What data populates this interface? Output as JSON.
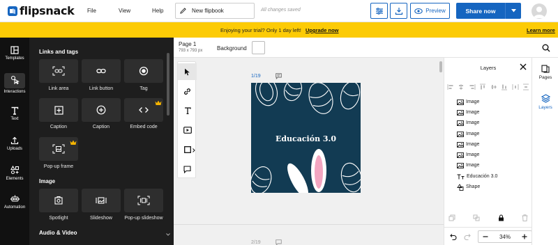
{
  "app": {
    "brand": "flipsnack",
    "menu": [
      "File",
      "View",
      "Help"
    ],
    "flipbook_title": "New flipbook",
    "save_status": "All changes saved",
    "preview_label": "Preview",
    "share_label": "Share now",
    "accent_color": "#1565c0"
  },
  "banner": {
    "message": "Enjoying your trial? Only 1 day left!",
    "upgrade_link": "Upgrade now",
    "learn_more": "Learn more",
    "color": "#fccb06"
  },
  "rail": {
    "items": [
      {
        "label": "Templates",
        "icon": "templates-icon"
      },
      {
        "label": "Interactions",
        "icon": "interactions-icon",
        "active": true
      },
      {
        "label": "Text",
        "icon": "text-icon"
      },
      {
        "label": "Uploads",
        "icon": "upload-icon"
      },
      {
        "label": "Elements",
        "icon": "elements-icon"
      },
      {
        "label": "Automation",
        "icon": "automation-icon"
      }
    ]
  },
  "panel": {
    "section_links": "Links and tags",
    "links": [
      {
        "label": "Link area",
        "icon": "link-area-icon"
      },
      {
        "label": "Link button",
        "icon": "link-button-icon"
      },
      {
        "label": "Tag",
        "icon": "tag-icon"
      },
      {
        "label": "Caption",
        "icon": "caption-area-icon"
      },
      {
        "label": "Caption",
        "icon": "caption-button-icon"
      },
      {
        "label": "Embed code",
        "icon": "embed-code-icon",
        "premium": true
      },
      {
        "label": "Pop-up frame",
        "icon": "popup-frame-icon",
        "premium": true
      }
    ],
    "section_image": "Image",
    "image_items": [
      {
        "label": "Spotlight",
        "icon": "spotlight-icon"
      },
      {
        "label": "Slideshow",
        "icon": "slideshow-icon"
      },
      {
        "label": "Pop-up slideshow",
        "icon": "popup-slideshow-icon"
      }
    ],
    "section_audio": "Audio & Video"
  },
  "canvas": {
    "page_label": "Page 1",
    "page_dimensions": "793 x 793 px",
    "background_label": "Background",
    "page1_num": "1/19",
    "page2_num": "2/19",
    "page_text": "Educación 3.0",
    "page_color": "#123b53"
  },
  "layers": {
    "title": "Layers",
    "items": [
      {
        "label": "Image",
        "icon": "image-icon"
      },
      {
        "label": "Image",
        "icon": "image-icon"
      },
      {
        "label": "Image",
        "icon": "image-icon"
      },
      {
        "label": "Image",
        "icon": "image-icon"
      },
      {
        "label": "Image",
        "icon": "image-icon"
      },
      {
        "label": "Image",
        "icon": "image-icon"
      },
      {
        "label": "Image",
        "icon": "image-icon"
      },
      {
        "label": "Educación 3.0",
        "icon": "text-layer-icon"
      },
      {
        "label": "Shape",
        "icon": "shape-icon"
      }
    ],
    "zoom": "34%"
  },
  "right_rail": {
    "items": [
      {
        "label": "Pages",
        "icon": "pages-icon"
      },
      {
        "label": "Layers",
        "icon": "layers-icon",
        "active": true
      }
    ]
  }
}
